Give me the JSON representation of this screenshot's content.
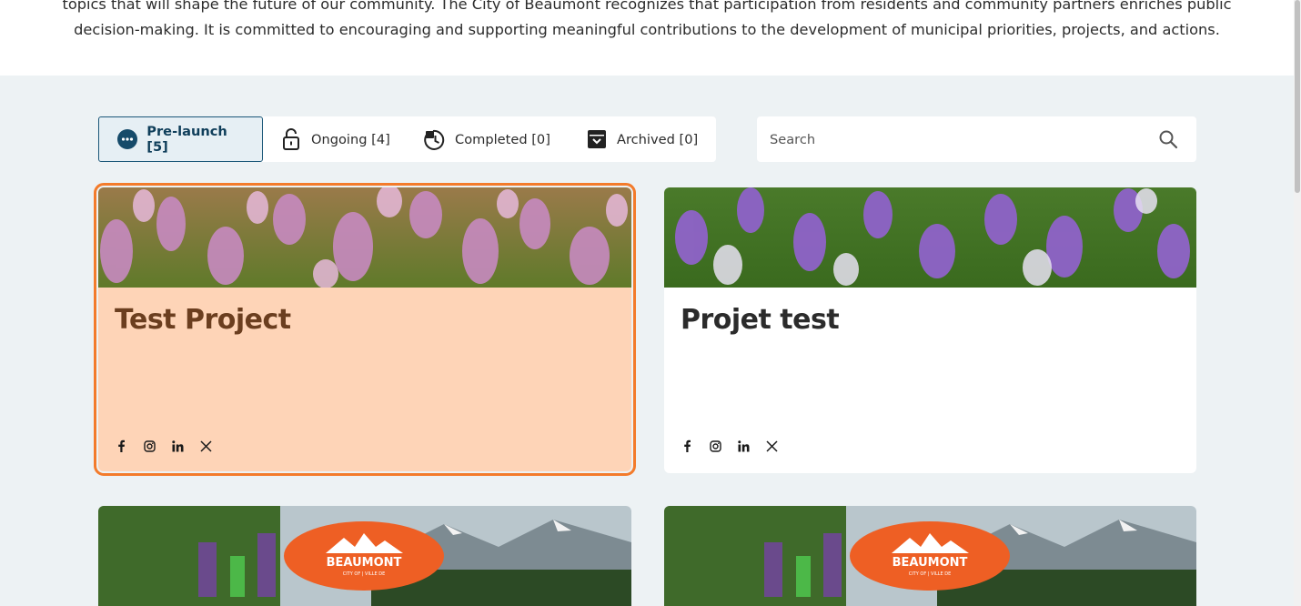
{
  "intro": {
    "line1": "topics that will shape the future of our community. The City of Beaumont recognizes that participation from residents and community partners enriches public",
    "line2": "decision-making. It is committed to encouraging and supporting meaningful contributions to the development of municipal priorities, projects, and actions."
  },
  "tabs": [
    {
      "label": "Pre-launch [5]",
      "icon": "ellipsis-circle-icon",
      "active": true
    },
    {
      "label": "Ongoing [4]",
      "icon": "unlock-icon",
      "active": false
    },
    {
      "label": "Completed [0]",
      "icon": "clock-check-icon",
      "active": false
    },
    {
      "label": "Archived [0]",
      "icon": "archive-box-icon",
      "active": false
    }
  ],
  "search": {
    "placeholder": "Search",
    "value": "",
    "icon": "search-icon"
  },
  "cards": [
    {
      "title": "Test Project",
      "image": "purple-crocus-flowers",
      "highlighted": true,
      "social": [
        "facebook-icon",
        "instagram-icon",
        "linkedin-icon",
        "x-icon"
      ]
    },
    {
      "title": "Projet test",
      "image": "purple-crocus-flowers",
      "highlighted": false,
      "social": [
        "facebook-icon",
        "instagram-icon",
        "linkedin-icon",
        "x-icon"
      ]
    },
    {
      "title": "",
      "image": "beaumont-hikers-mountains",
      "logo_text": "BEAUMONT",
      "logo_sub": "CITY OF | VILLE DE"
    },
    {
      "title": "",
      "image": "beaumont-hikers-mountains",
      "logo_text": "BEAUMONT",
      "logo_sub": "CITY OF | VILLE DE"
    }
  ],
  "colors": {
    "accent": "#f37b2b",
    "active_tab_border": "#1b5778",
    "highlight_bg": "#fed4b7",
    "page_bg": "#edf2f4"
  }
}
